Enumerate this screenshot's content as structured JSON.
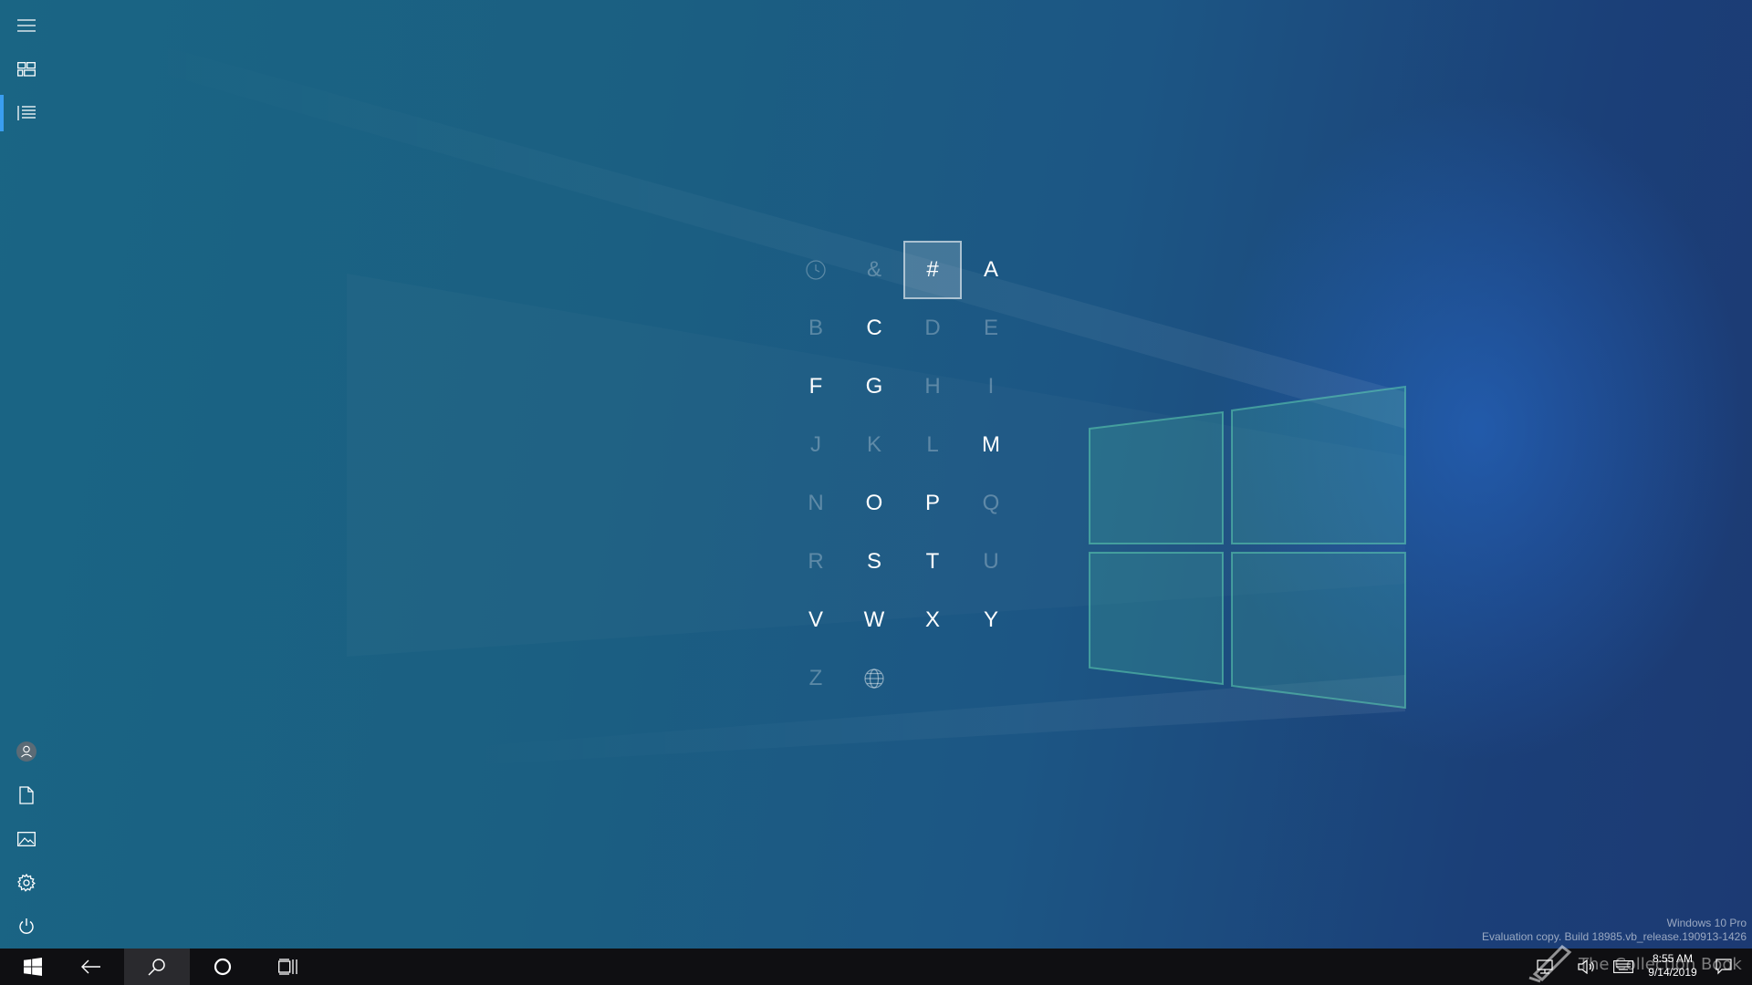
{
  "sidebar": {
    "top": [
      {
        "name": "hamburger-menu-icon"
      },
      {
        "name": "tiles-view-icon"
      },
      {
        "name": "all-apps-list-icon",
        "active": true
      }
    ],
    "bottom": [
      {
        "name": "user-account-icon"
      },
      {
        "name": "documents-icon"
      },
      {
        "name": "pictures-icon"
      },
      {
        "name": "settings-gear-icon"
      },
      {
        "name": "power-icon"
      }
    ]
  },
  "jump_list": {
    "cells": [
      {
        "label": "",
        "icon": "recent-clock-icon",
        "enabled": false
      },
      {
        "label": "&",
        "enabled": false
      },
      {
        "label": "#",
        "enabled": true,
        "selected": true
      },
      {
        "label": "A",
        "enabled": true
      },
      {
        "label": "B",
        "enabled": false
      },
      {
        "label": "C",
        "enabled": true
      },
      {
        "label": "D",
        "enabled": false
      },
      {
        "label": "E",
        "enabled": false
      },
      {
        "label": "F",
        "enabled": true
      },
      {
        "label": "G",
        "enabled": true
      },
      {
        "label": "H",
        "enabled": false
      },
      {
        "label": "I",
        "enabled": false
      },
      {
        "label": "J",
        "enabled": false
      },
      {
        "label": "K",
        "enabled": false
      },
      {
        "label": "L",
        "enabled": false
      },
      {
        "label": "M",
        "enabled": true
      },
      {
        "label": "N",
        "enabled": false
      },
      {
        "label": "O",
        "enabled": true
      },
      {
        "label": "P",
        "enabled": true
      },
      {
        "label": "Q",
        "enabled": false
      },
      {
        "label": "R",
        "enabled": false
      },
      {
        "label": "S",
        "enabled": true
      },
      {
        "label": "T",
        "enabled": true
      },
      {
        "label": "U",
        "enabled": false
      },
      {
        "label": "V",
        "enabled": true
      },
      {
        "label": "W",
        "enabled": true
      },
      {
        "label": "X",
        "enabled": true
      },
      {
        "label": "Y",
        "enabled": true
      },
      {
        "label": "Z",
        "enabled": false
      },
      {
        "label": "",
        "icon": "globe-icon",
        "enabled": true
      }
    ]
  },
  "watermark": {
    "edition": "Windows 10 Pro",
    "build": "Evaluation copy. Build 18985.vb_release.190913-1426"
  },
  "overlay": {
    "collection_text": "The Collection Book"
  },
  "taskbar": {
    "buttons": [
      {
        "name": "start-button"
      },
      {
        "name": "back-button"
      },
      {
        "name": "search-button",
        "pressed": true
      },
      {
        "name": "cortana-button"
      },
      {
        "name": "task-view-button"
      }
    ],
    "tray": [
      {
        "name": "network-icon"
      },
      {
        "name": "volume-icon"
      },
      {
        "name": "touch-keyboard-icon"
      }
    ],
    "clock": {
      "time": "8:55 AM",
      "date": "9/14/2019"
    }
  },
  "colors": {
    "accent": "#3a9ef0",
    "taskbar": "#0f0f12"
  }
}
